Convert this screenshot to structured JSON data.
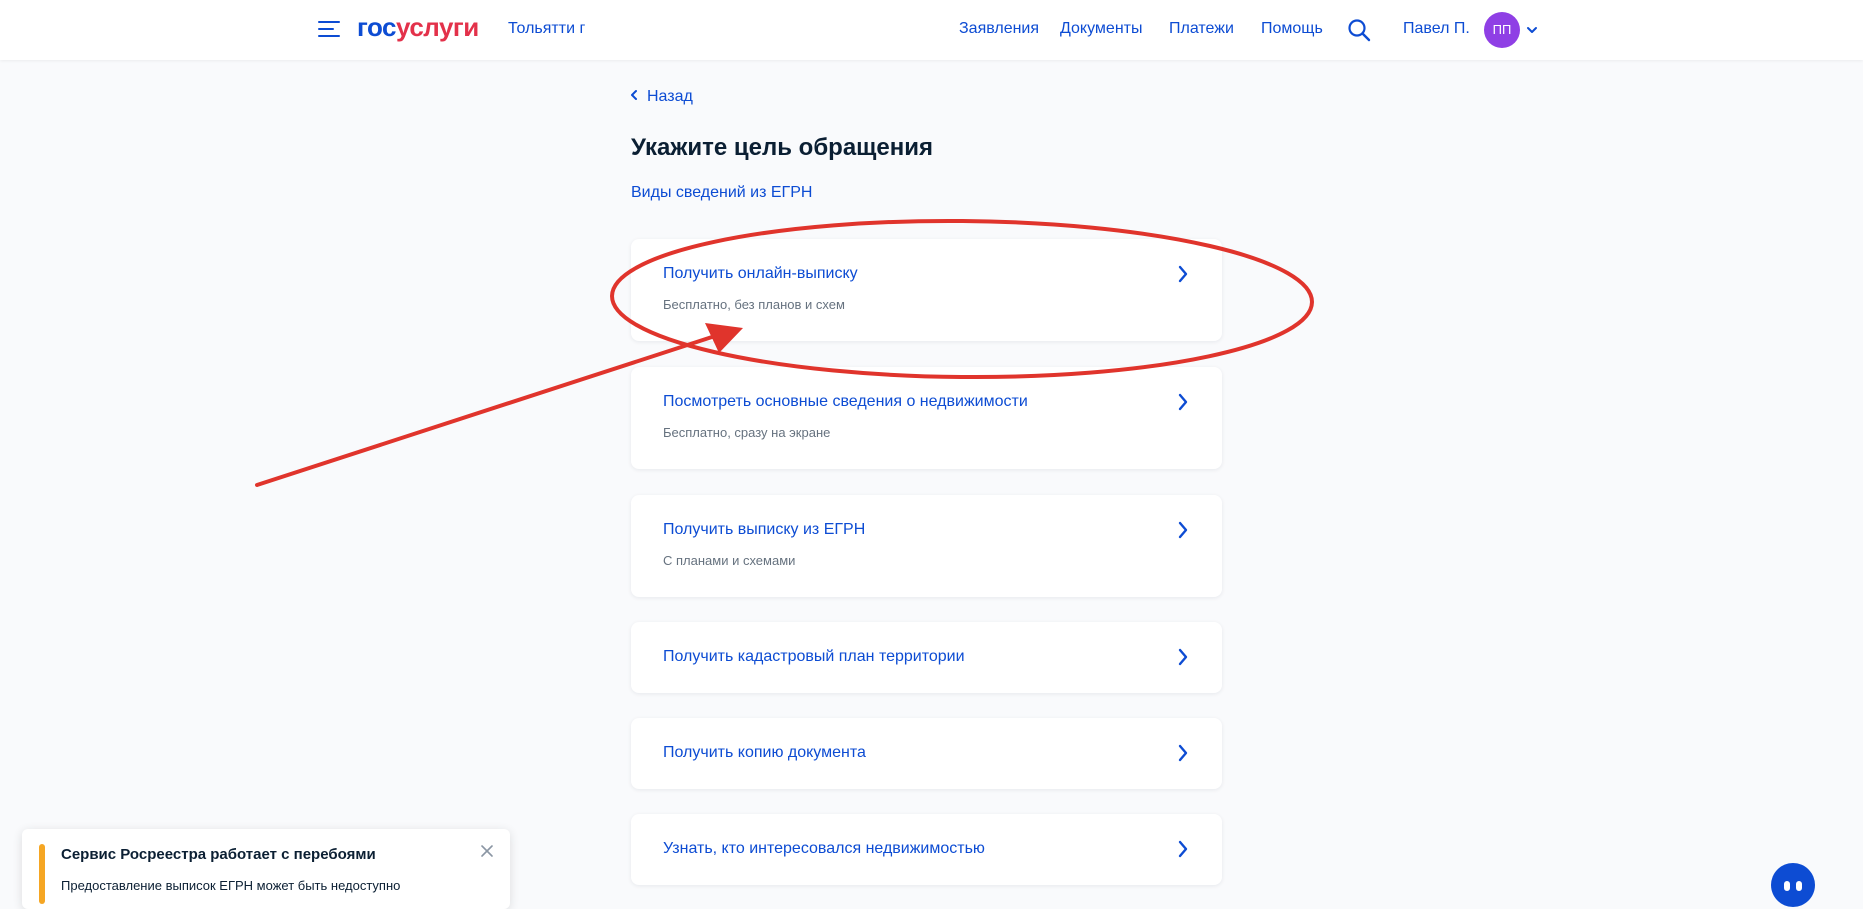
{
  "header": {
    "logo_part1": "гос",
    "logo_part2": "услуги",
    "city": "Тольятти г",
    "nav": [
      "Заявления",
      "Документы",
      "Платежи",
      "Помощь"
    ],
    "user_name": "Павел П.",
    "avatar_initials": "ПП"
  },
  "page": {
    "back_label": "Назад",
    "title": "Укажите цель обращения",
    "subtitle_link": "Виды сведений из ЕГРН"
  },
  "options": [
    {
      "title": "Получить онлайн-выписку",
      "desc": "Бесплатно, без планов и схем"
    },
    {
      "title": "Посмотреть основные сведения о недвижимости",
      "desc": "Бесплатно, сразу на экране"
    },
    {
      "title": "Получить выписку из ЕГРН",
      "desc": "С планами и схемами"
    },
    {
      "title": "Получить кадастровый план территории"
    },
    {
      "title": "Получить копию документа"
    },
    {
      "title": "Узнать, кто интересовался недвижимостью"
    }
  ],
  "toast": {
    "title": "Сервис Росреестра работает с перебоями",
    "text": "Предоставление выписок ЕГРН может быть недоступно"
  },
  "colors": {
    "brand_blue": "#0d4cd3",
    "brand_red": "#e3314a",
    "annotation_red": "#e0342c",
    "avatar_purple": "#8f3fe5",
    "warning_orange": "#f5a623"
  },
  "icons": [
    "menu-icon",
    "search-icon",
    "chevron-down-icon",
    "chevron-left-icon",
    "chevron-right-icon",
    "close-icon",
    "chat-bot-icon"
  ]
}
